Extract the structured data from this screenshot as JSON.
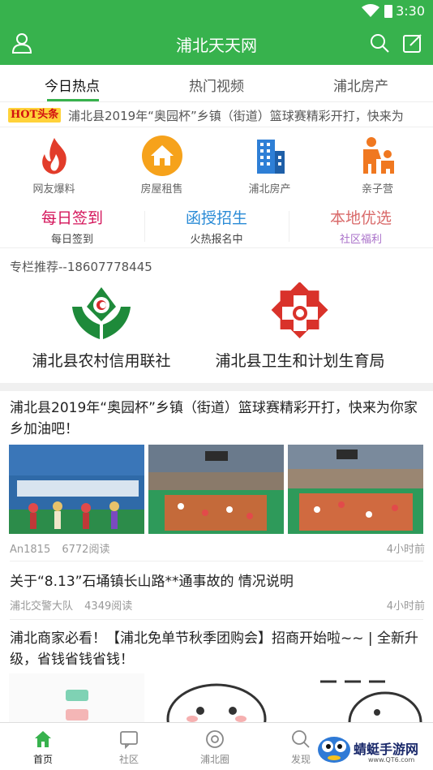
{
  "status": {
    "time": "3:30"
  },
  "appbar": {
    "title": "浦北天天网"
  },
  "tabs": [
    {
      "label": "今日热点"
    },
    {
      "label": "热门视频"
    },
    {
      "label": "浦北房产"
    }
  ],
  "hot": {
    "tag": "HOT头条",
    "text": "浦北县2019年“奥园杯”乡镇（街道）篮球赛精彩开打，快来为"
  },
  "grid": [
    {
      "label": "网友爆料",
      "icon": "flame-icon"
    },
    {
      "label": "房屋租售",
      "icon": "house-icon"
    },
    {
      "label": "浦北房产",
      "icon": "building-icon"
    },
    {
      "label": "亲子营",
      "icon": "parent-child-icon"
    }
  ],
  "features": [
    {
      "title": "每日签到",
      "subtitle": "每日签到",
      "color": "#d4145a",
      "subcolor": "#444444"
    },
    {
      "title": "函授招生",
      "subtitle": "火热报名中",
      "color": "#2a8bd6",
      "subcolor": "#444444"
    },
    {
      "title": "本地优选",
      "subtitle": "社区福利",
      "color": "#d96a6a",
      "subcolor": "#a970c9"
    }
  ],
  "column": {
    "heading": "专栏推荐--18607778445",
    "orgs": [
      {
        "name": "浦北县农村信用联社"
      },
      {
        "name": "浦北县卫生和计划生育局"
      }
    ]
  },
  "articles": [
    {
      "title": "浦北县2019年“奥园杯”乡镇（街道）篮球赛精彩开打，快来为你家乡加油吧！",
      "source": "An1815",
      "reads": "6772阅读",
      "time": "4小时前"
    },
    {
      "title": "关于“8.13”石埇镇长山路**通事故的 情况说明",
      "source": "浦北交警大队",
      "reads": "4349阅读",
      "time": "4小时前"
    },
    {
      "title": "浦北商家必看！【浦北免单节秋季团购会】招商开始啦~~ | 全新升级，省钱省钱省钱！"
    }
  ],
  "nav": [
    {
      "label": "首页"
    },
    {
      "label": "社区"
    },
    {
      "label": "浦北圈"
    },
    {
      "label": "发现"
    }
  ],
  "watermark": {
    "text": "蜻蜓手游网",
    "url": "www.QT6.com"
  },
  "colors": {
    "brand": "#37b24d",
    "hot_tag_bg": "#ffd23a",
    "hot_tag_text": "#d21010"
  }
}
